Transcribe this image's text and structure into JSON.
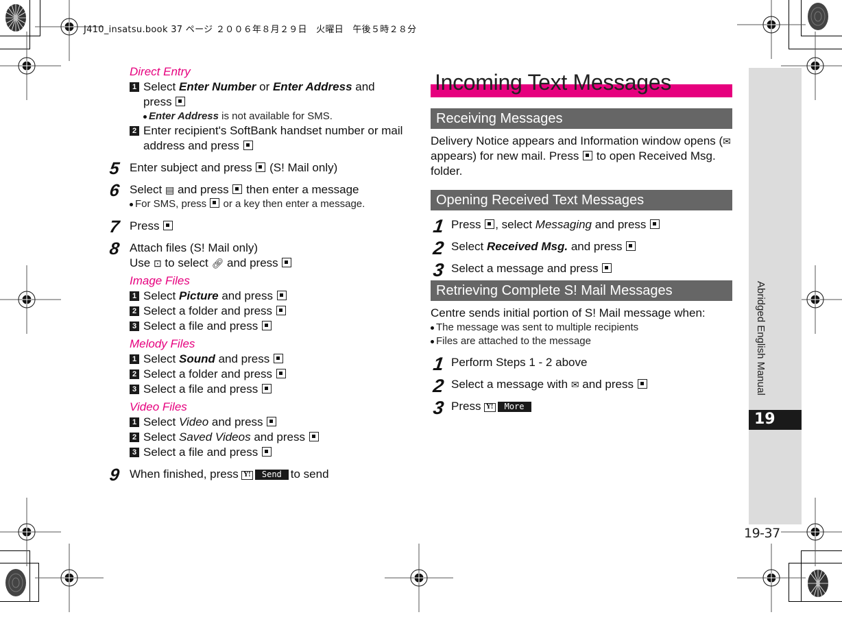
{
  "slug": "J410_insatsu.book  37 ページ  ２００６年８月２９日　火曜日　午後５時２８分",
  "left": {
    "direct_entry": {
      "heading": "Direct Entry",
      "steps": [
        {
          "num": "1",
          "pre": "Select ",
          "kw1": "Enter Number",
          "mid": " or ",
          "kw2": "Enter Address",
          "post": " and press",
          "note_kw": "Enter Address",
          "note_rest": " is not available for SMS."
        },
        {
          "num": "2",
          "text": "Enter recipient's SoftBank handset number or mail address and press"
        }
      ]
    },
    "step5": {
      "num": "5",
      "text_a": "Enter subject and press",
      "text_b": " (S! Mail only)"
    },
    "step6": {
      "num": "6",
      "text_a": "Select",
      "text_b": " and press",
      "text_c": " then enter a message",
      "note_a": "For SMS, press",
      "note_b": " or a key then enter a message."
    },
    "step7": {
      "num": "7",
      "text": "Press"
    },
    "step8": {
      "num": "8",
      "line1": "Attach files (S! Mail only)",
      "line2_a": "Use",
      "line2_b": " to select",
      "line2_c": " and press"
    },
    "image_files": {
      "heading": "Image Files",
      "steps": [
        {
          "num": "1",
          "pre": "Select ",
          "kw": "Picture",
          "post": " and press"
        },
        {
          "num": "2",
          "text": "Select a folder and press"
        },
        {
          "num": "3",
          "text": "Select a file and press"
        }
      ]
    },
    "melody_files": {
      "heading": "Melody Files",
      "steps": [
        {
          "num": "1",
          "pre": "Select ",
          "kw": "Sound",
          "post": " and press"
        },
        {
          "num": "2",
          "text": "Select a folder and press"
        },
        {
          "num": "3",
          "text": "Select a file and press"
        }
      ]
    },
    "video_files": {
      "heading": "Video Files",
      "steps": [
        {
          "num": "1",
          "pre": "Select ",
          "kw": "Video",
          "post": " and press"
        },
        {
          "num": "2",
          "pre": "Select ",
          "kw": "Saved Videos",
          "post": " and press"
        },
        {
          "num": "3",
          "text": "Select a file and press"
        }
      ]
    },
    "step9": {
      "num": "9",
      "text_a": "When finished, press",
      "softkey": "Send",
      "text_b": "to send"
    }
  },
  "right": {
    "title": "Incoming Text Messages",
    "receiving": {
      "heading": "Receiving Messages",
      "para_a": "Delivery Notice appears and Information window opens (",
      "para_b": " appears) for new mail. Press",
      "para_c": " to open Received Msg. folder."
    },
    "opening": {
      "heading": "Opening Received Text Messages",
      "steps": [
        {
          "num": "1",
          "a": "Press",
          "b": ", select ",
          "kw": "Messaging",
          "c": " and press"
        },
        {
          "num": "2",
          "a": "Select ",
          "kw": "Received Msg.",
          "c": " and press"
        },
        {
          "num": "3",
          "a": "Select a message and press"
        }
      ]
    },
    "retrieving": {
      "heading": "Retrieving Complete S! Mail Messages",
      "intro": "Centre sends initial portion of S! Mail message when:",
      "bullets": [
        "The message was sent to multiple recipients",
        "Files are attached to the message"
      ],
      "steps": [
        {
          "num": "1",
          "a": "Perform Steps 1 - 2 above"
        },
        {
          "num": "2",
          "a": "Select a message with",
          "c": " and press"
        },
        {
          "num": "3",
          "a": "Press",
          "softkey": "More"
        }
      ]
    }
  },
  "side": {
    "label": "Abridged English Manual",
    "chapter": "19",
    "page": "19-37"
  },
  "icons": {
    "center_key": "center-select-key-icon",
    "message_body": "message-body-icon",
    "nav_lr": "left-right-nav-key-icon",
    "attachment": "paperclip-attachment-icon",
    "envelope": "envelope-icon",
    "partial_mail": "partial-mail-icon",
    "yahoo_key": "yahoo-key-icon"
  },
  "colors": {
    "accent_pink": "#e6007e",
    "section_gray": "#666666",
    "tab_gray": "#dcdcdc"
  }
}
